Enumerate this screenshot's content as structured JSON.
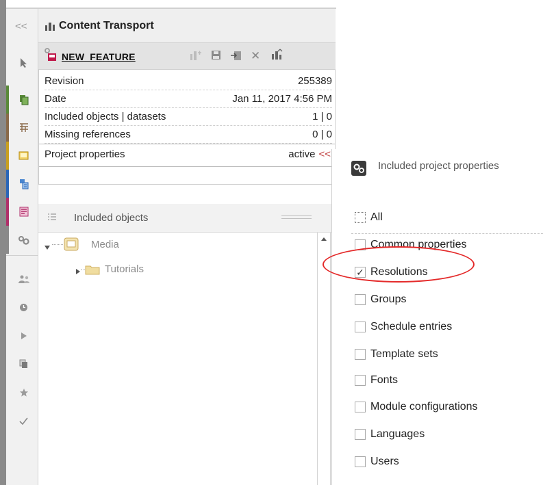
{
  "window": {
    "collapse_label": "<<",
    "panel_title": "Content Transport"
  },
  "feature": {
    "name": "NEW_FEATURE"
  },
  "details": [
    {
      "label": "Revision",
      "value": "255389"
    },
    {
      "label": "Date",
      "value": "Jan 11, 2017 4:56 PM"
    },
    {
      "label": "Included objects | datasets",
      "value": "1 | 0"
    },
    {
      "label": "Missing references",
      "value": "0 | 0"
    },
    {
      "label": "Project properties",
      "value": "active"
    }
  ],
  "project_properties_chevron": "<<",
  "included_objects": {
    "title": "Included objects",
    "tree": [
      {
        "label": "Media",
        "expanded": true
      },
      {
        "label": "Tutorials",
        "expanded": false
      }
    ]
  },
  "popup": {
    "title": "Included project properties",
    "options": [
      {
        "label": "All",
        "checked": false
      },
      {
        "label": "Common properties",
        "checked": false
      },
      {
        "label": "Resolutions",
        "checked": true
      },
      {
        "label": "Groups",
        "checked": false
      },
      {
        "label": "Schedule entries",
        "checked": false
      },
      {
        "label": "Template sets",
        "checked": false
      },
      {
        "label": "Fonts",
        "checked": false
      },
      {
        "label": "Module configurations",
        "checked": false
      },
      {
        "label": "Languages",
        "checked": false
      },
      {
        "label": "Users",
        "checked": false
      }
    ],
    "check_mark": "✓",
    "highlight_color": "#e42a2a"
  },
  "iconbar": {
    "items": [
      {
        "icon": "pointer-icon",
        "color": "#8a8a8a"
      },
      {
        "icon": "pages-icon",
        "color": "#5a8a3a"
      },
      {
        "icon": "site-structure-icon",
        "color": "#8a6a4a"
      },
      {
        "icon": "media-icon",
        "color": "#c9a020"
      },
      {
        "icon": "datasources-icon",
        "color": "#2a66b8"
      },
      {
        "icon": "templates-icon",
        "color": "#b0306a"
      },
      {
        "icon": "global-settings-icon",
        "color": "#7a7a7a"
      },
      {
        "icon": "users-icon",
        "color": "#888888"
      },
      {
        "icon": "clock-icon",
        "color": "#888888"
      },
      {
        "icon": "play-icon",
        "color": "#888888"
      },
      {
        "icon": "copy-icon",
        "color": "#888888"
      },
      {
        "icon": "star-icon",
        "color": "#888888"
      },
      {
        "icon": "check-icon",
        "color": "#888888"
      }
    ]
  }
}
